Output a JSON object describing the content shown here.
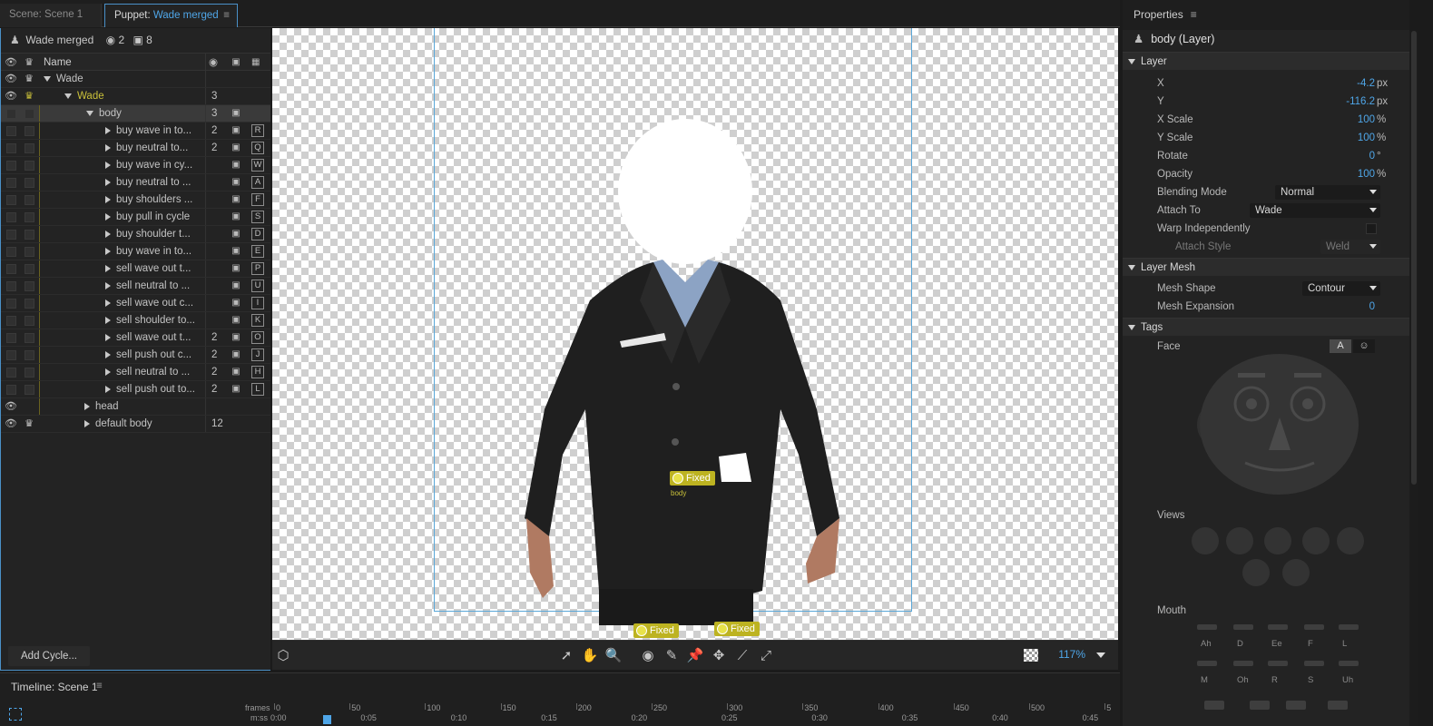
{
  "tabs": {
    "scene": "Scene: Scene 1",
    "puppet_prefix": "Puppet: ",
    "puppet_name": "Wade merged",
    "menu_glyph": "≡"
  },
  "layers": {
    "title": "Wade merged",
    "handle_count": "2",
    "layer_count": "8",
    "col_name": "Name",
    "add_cycle": "Add Cycle...",
    "rows": [
      {
        "name": "Wade",
        "num": "",
        "cam": false,
        "key": "",
        "eye": true,
        "crown": true,
        "gold": false
      },
      {
        "name": "Wade",
        "num": "3",
        "cam": false,
        "key": "",
        "eye": true,
        "crown": true,
        "gold": true
      },
      {
        "name": "body",
        "num": "3",
        "cam": true,
        "key": "",
        "eye": false,
        "crown": false,
        "gold": false
      },
      {
        "name": "buy wave in to...",
        "num": "2",
        "cam": true,
        "key": "R"
      },
      {
        "name": "buy  neutral to...",
        "num": "2",
        "cam": true,
        "key": "Q"
      },
      {
        "name": "buy wave in cy...",
        "num": "",
        "cam": true,
        "key": "W"
      },
      {
        "name": "buy neutral to ...",
        "num": "",
        "cam": true,
        "key": "A"
      },
      {
        "name": "buy shoulders ...",
        "num": "",
        "cam": true,
        "key": "F"
      },
      {
        "name": "buy pull in cycle",
        "num": "",
        "cam": true,
        "key": "S"
      },
      {
        "name": "buy shoulder t...",
        "num": "",
        "cam": true,
        "key": "D"
      },
      {
        "name": "buy wave in  to...",
        "num": "",
        "cam": true,
        "key": "E"
      },
      {
        "name": "sell wave out t...",
        "num": "",
        "cam": true,
        "key": "P"
      },
      {
        "name": "sell neutral to ...",
        "num": "",
        "cam": true,
        "key": "U"
      },
      {
        "name": "sell wave out c...",
        "num": "",
        "cam": true,
        "key": "I"
      },
      {
        "name": "sell shoulder to...",
        "num": "",
        "cam": true,
        "key": "K"
      },
      {
        "name": "sell wave out t...",
        "num": "2",
        "cam": true,
        "key": "O"
      },
      {
        "name": "sell push out c...",
        "num": "2",
        "cam": true,
        "key": "J"
      },
      {
        "name": "sell neutral to ...",
        "num": "2",
        "cam": true,
        "key": "H"
      },
      {
        "name": "sell push out to...",
        "num": "2",
        "cam": true,
        "key": "L"
      },
      {
        "name": "head",
        "num": "",
        "cam": false,
        "key": ""
      },
      {
        "name": "default body",
        "num": "12",
        "cam": false,
        "key": ""
      }
    ]
  },
  "canvas": {
    "handle_fixed": "Fixed",
    "handle_body_label": "body",
    "zoom": "117%"
  },
  "timeline": {
    "title": "Timeline: Scene 1",
    "frames_label": "frames",
    "mmss_label": "m:ss",
    "frames": [
      "0",
      "50",
      "100",
      "150",
      "200",
      "250",
      "300",
      "350",
      "400",
      "450",
      "500",
      "5"
    ],
    "times": [
      "0:00",
      "0:05",
      "0:10",
      "0:15",
      "0:20",
      "0:25",
      "0:30",
      "0:35",
      "0:40",
      "0:45"
    ]
  },
  "properties": {
    "tab": "Properties",
    "title": "body (Layer)",
    "section_layer": "Layer",
    "x_label": "X",
    "x_value": "-4.2",
    "x_unit": "px",
    "y_label": "Y",
    "y_value": "-116.2",
    "y_unit": "px",
    "xscale_label": "X Scale",
    "xscale_value": "100",
    "xscale_unit": "%",
    "yscale_label": "Y Scale",
    "yscale_value": "100",
    "yscale_unit": "%",
    "rotate_label": "Rotate",
    "rotate_value": "0",
    "rotate_unit": "°",
    "opacity_label": "Opacity",
    "opacity_value": "100",
    "opacity_unit": "%",
    "blend_label": "Blending Mode",
    "blend_value": "Normal",
    "attach_label": "Attach To",
    "attach_value": "Wade",
    "warp_label": "Warp Independently",
    "attach_style_label": "Attach Style",
    "attach_style_value": "Weld",
    "section_mesh": "Layer Mesh",
    "mesh_shape_label": "Mesh Shape",
    "mesh_shape_value": "Contour",
    "mesh_exp_label": "Mesh Expansion",
    "mesh_exp_value": "0",
    "section_tags": "Tags",
    "face_label": "Face",
    "tag_a": "A",
    "views_label": "Views",
    "mouth_label": "Mouth",
    "mouth_shapes": [
      "Ah",
      "D",
      "Ee",
      "F",
      "L",
      "M",
      "Oh",
      "R",
      "S",
      "Uh"
    ]
  }
}
